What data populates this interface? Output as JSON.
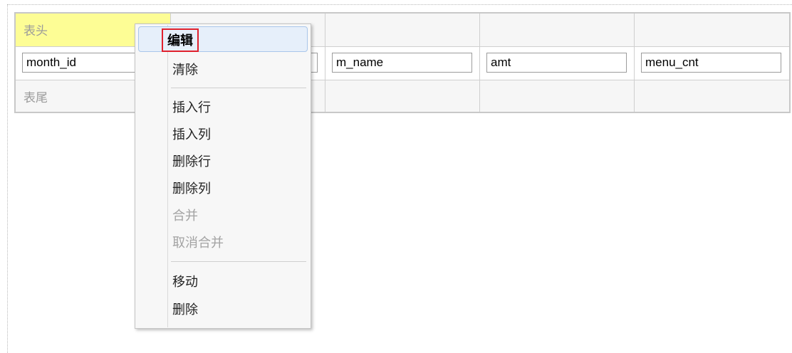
{
  "table": {
    "header_label": "表头",
    "footer_label": "表尾",
    "fields": [
      "month_id",
      "",
      "m_name",
      "amt",
      "menu_cnt"
    ]
  },
  "context_menu": {
    "items": [
      {
        "label": "编辑",
        "state": "active"
      },
      {
        "label": "清除",
        "state": "enabled"
      },
      {
        "label": "插入行",
        "state": "enabled"
      },
      {
        "label": "插入列",
        "state": "enabled"
      },
      {
        "label": "删除行",
        "state": "enabled"
      },
      {
        "label": "删除列",
        "state": "enabled"
      },
      {
        "label": "合并",
        "state": "disabled"
      },
      {
        "label": "取消合并",
        "state": "disabled"
      },
      {
        "label": "移动",
        "state": "enabled"
      },
      {
        "label": "删除",
        "state": "enabled"
      }
    ]
  },
  "colors": {
    "header_highlight": "#fdfd95",
    "selection_outline": "#e0212d"
  }
}
